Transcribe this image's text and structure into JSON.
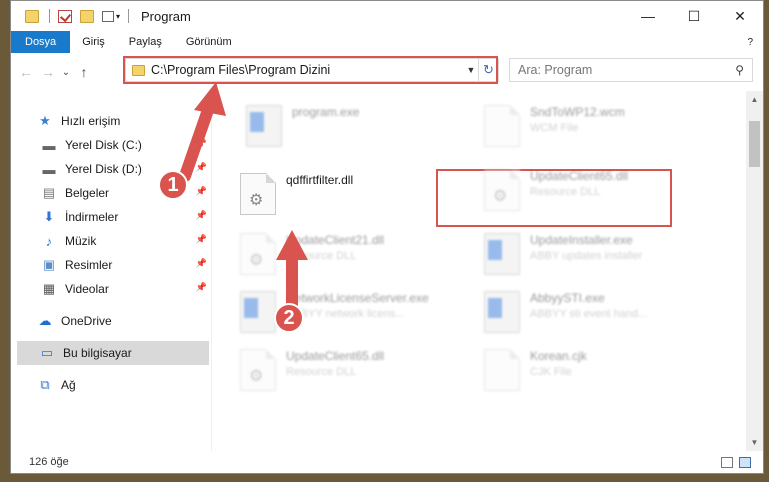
{
  "window": {
    "title": "Program",
    "minimize": "—",
    "maximize": "☐",
    "close": "✕"
  },
  "ribbon": {
    "tabs": [
      "Dosya",
      "Giriş",
      "Paylaş",
      "Görünüm"
    ],
    "help": "?"
  },
  "navigation": {
    "back": "←",
    "forward": "→",
    "recent": "⌄",
    "up": "↑",
    "address": "C:\\Program Files\\Program Dizini",
    "refresh": "↻",
    "search_placeholder": "Ara: Program",
    "search_icon": "⚲"
  },
  "sidebar": {
    "quick_access": "Hızlı erişim",
    "items": [
      {
        "label": "Yerel Disk (C:)",
        "icon": "drive-icon"
      },
      {
        "label": "Yerel Disk (D:)",
        "icon": "drive-icon"
      },
      {
        "label": "Belgeler",
        "icon": "documents-icon"
      },
      {
        "label": "İndirmeler",
        "icon": "download-icon"
      },
      {
        "label": "Müzik",
        "icon": "music-icon"
      },
      {
        "label": "Resimler",
        "icon": "pictures-icon"
      },
      {
        "label": "Videolar",
        "icon": "videos-icon"
      }
    ],
    "onedrive": "OneDrive",
    "this_pc": "Bu bilgisayar",
    "network": "Ağ"
  },
  "files": [
    {
      "name": "program.exe",
      "sub": "",
      "icon": "exe-icon"
    },
    {
      "name": "SndToWP12.wcm",
      "sub": "WCM File",
      "icon": "doc-icon"
    },
    {
      "name": "qdffirtfilter.dll",
      "sub": "",
      "icon": "dll-icon"
    },
    {
      "name": "UpdateClient65.dll",
      "sub": "Resource DLL",
      "icon": "dll-icon"
    },
    {
      "name": "UpdateClient21.dll",
      "sub": "Resource DLL",
      "icon": "dll-icon"
    },
    {
      "name": "UpdateInstaller.exe",
      "sub": "ABBY updates installer",
      "icon": "app-icon"
    },
    {
      "name": "NetworkLicenseServer.exe",
      "sub": "ABBYY network licens...",
      "icon": "app-icon"
    },
    {
      "name": "AbbyySTI.exe",
      "sub": "ABBYY sti event hand...",
      "icon": "app-icon"
    },
    {
      "name": "UpdateClient65.dll",
      "sub": "Resource DLL",
      "icon": "dll-icon"
    },
    {
      "name": "Korean.cjk",
      "sub": "CJK File",
      "icon": "doc-icon"
    }
  ],
  "status": {
    "count": "126 öğe"
  },
  "annotations": {
    "step1": "1",
    "step2": "2",
    "color": "#d9534f"
  }
}
